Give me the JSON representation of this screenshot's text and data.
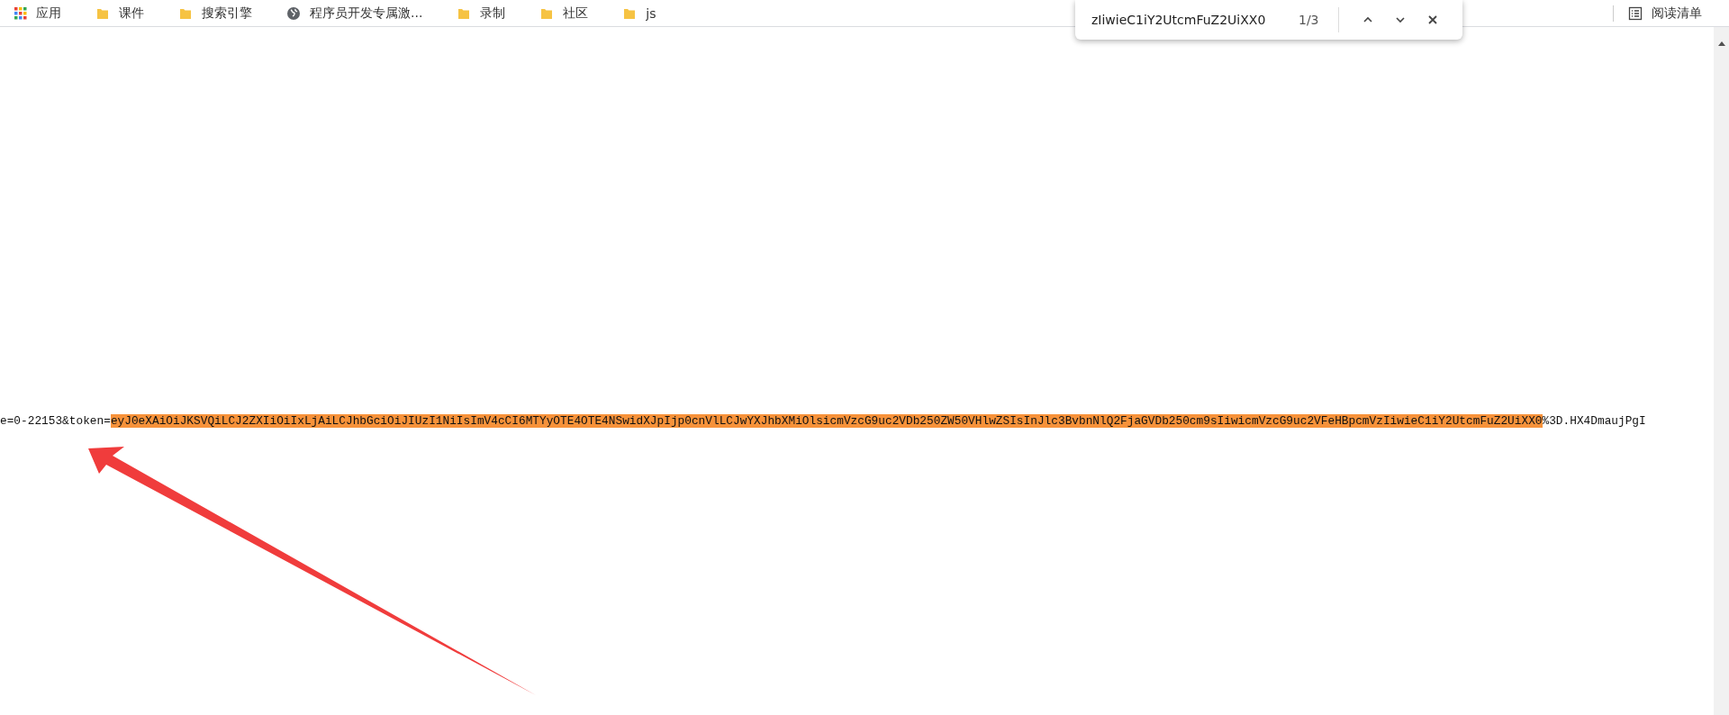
{
  "bookmarks_bar": {
    "items": [
      {
        "label": "应用",
        "kind": "apps"
      },
      {
        "label": "课件",
        "kind": "folder"
      },
      {
        "label": "搜索引擎",
        "kind": "folder"
      },
      {
        "label": "程序员开发专属激...",
        "kind": "site"
      },
      {
        "label": "录制",
        "kind": "folder"
      },
      {
        "label": "社区",
        "kind": "folder"
      },
      {
        "label": "js",
        "kind": "folder"
      }
    ],
    "reading_list": "阅读清单"
  },
  "find_bar": {
    "query": "zIiwieC1iY2UtcmFuZ2UiXX0",
    "count": "1/3"
  },
  "page": {
    "text_before": "e=0-22153&token=",
    "match": "eyJ0eXAiOiJKSVQiLCJ2ZXIiOiIxLjAiLCJhbGciOiJIUzI1NiIsImV4cCI6MTYyOTE4OTE4NSwidXJpIjp0cnVlLCJwYXJhbXMiOlsicmVzcG9uc2VDb250ZW50VHlwZSIsInJlc3BvbnNlQ2FjaGVDb250cm9sIiwicmVzcG9uc2VFeHBpcmVzIiwieC1iY2UtcmFuZ2UiXX0",
    "text_after": "%3D.HX4DmaujPgI"
  }
}
